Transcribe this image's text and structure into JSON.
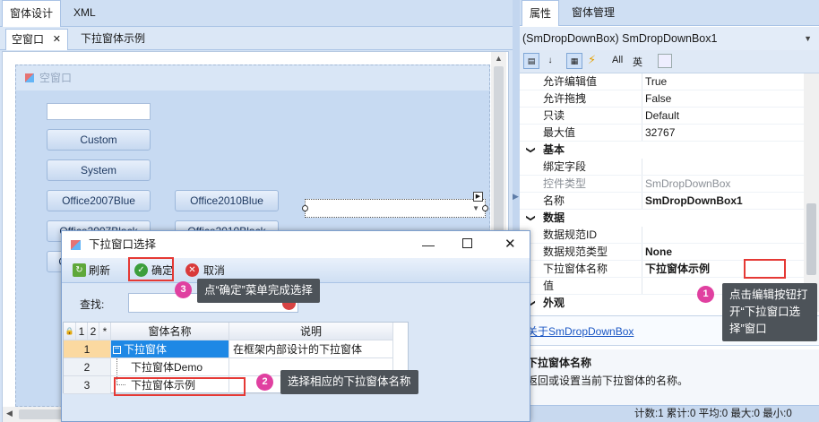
{
  "designer": {
    "top_tabs": [
      "窗体设计",
      "XML"
    ],
    "doc_tabs": [
      {
        "label": "空窗口",
        "close": "✕"
      },
      {
        "label": "下拉窗体示例"
      }
    ],
    "canvas_title": "空窗口",
    "buttons": [
      "Custom",
      "System",
      "Office2007Blue",
      "Office2010Blue",
      "Office2007Black",
      "Office2010Black",
      "O"
    ]
  },
  "properties": {
    "tabs": [
      "属性",
      "窗体管理"
    ],
    "selector": "(SmDropDownBox) SmDropDownBox1",
    "toolbar_text": [
      "All",
      "英"
    ],
    "rows": [
      {
        "kind": "row",
        "key": "允许编辑值",
        "value": "True"
      },
      {
        "kind": "row",
        "key": "允许拖拽",
        "value": "False"
      },
      {
        "kind": "row",
        "key": "只读",
        "value": "Default"
      },
      {
        "kind": "row",
        "key": "最大值",
        "value": "32767"
      },
      {
        "kind": "cat",
        "key": "基本"
      },
      {
        "kind": "row",
        "key": "绑定字段",
        "value": ""
      },
      {
        "kind": "row",
        "key": "控件类型",
        "value": "SmDropDownBox",
        "muted": true
      },
      {
        "kind": "row",
        "key": "名称",
        "value": "SmDropDownBox1",
        "bold": true
      },
      {
        "kind": "cat",
        "key": "数据"
      },
      {
        "kind": "row",
        "key": "数据规范ID",
        "value": ""
      },
      {
        "kind": "row",
        "key": "数据规范类型",
        "value": "None",
        "bold": true
      },
      {
        "kind": "row",
        "key": "下拉窗体名称",
        "value": "下拉窗体示例",
        "bold": true
      },
      {
        "kind": "row",
        "key": "值",
        "value": ""
      },
      {
        "kind": "cat",
        "key": "外观"
      }
    ],
    "link_text": "关于SmDropDownBox",
    "desc_title": "下拉窗体名称",
    "desc_text": "返回或设置当前下拉窗体的名称。",
    "status": "计数:1 累计:0 平均:0 最大:0 最小:0"
  },
  "dialog": {
    "title": "下拉窗口选择",
    "toolbar": {
      "refresh": "刷新",
      "ok": "确定",
      "cancel": "取消"
    },
    "search_label": "查找:",
    "grid_headers": [
      "1",
      "2",
      "*",
      "窗体名称",
      "说明"
    ],
    "rows": [
      {
        "num": "1",
        "name": "下拉窗体",
        "desc": "在框架内部设计的下拉窗体",
        "expander": "−"
      },
      {
        "num": "2",
        "name": "下拉窗体Demo",
        "desc": ""
      },
      {
        "num": "3",
        "name": "下拉窗体示例",
        "desc": ""
      }
    ]
  },
  "annotations": [
    {
      "num": "1",
      "text_lines": [
        "点击编辑按钮打",
        "开“下拉窗口选",
        "择”窗口"
      ]
    },
    {
      "num": "2",
      "text": "选择相应的下拉窗体名称"
    },
    {
      "num": "3",
      "text": "点“确定”菜单完成选择"
    }
  ],
  "colors": {
    "accent": "#3399ff",
    "callout": "#4d5359",
    "badge": "#e040a0",
    "highlight": "#e53935",
    "selection": "#1e88e5"
  }
}
